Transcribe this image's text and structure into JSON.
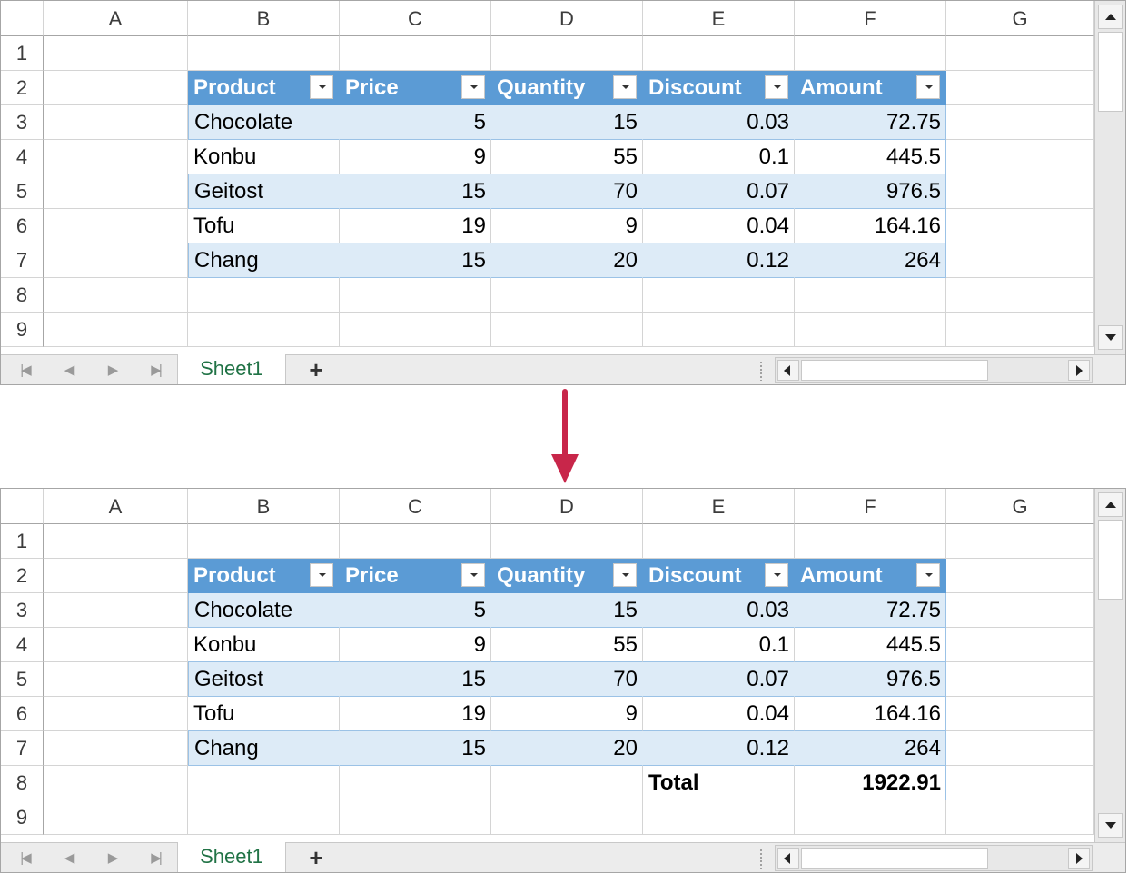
{
  "columns": [
    "A",
    "B",
    "C",
    "D",
    "E",
    "F",
    "G"
  ],
  "row_numbers": [
    "1",
    "2",
    "3",
    "4",
    "5",
    "6",
    "7",
    "8",
    "9"
  ],
  "table": {
    "headers": [
      "Product",
      "Price",
      "Quantity",
      "Discount",
      "Amount"
    ],
    "rows": [
      [
        "Chocolate",
        "5",
        "15",
        "0.03",
        "72.75"
      ],
      [
        "Konbu",
        "9",
        "55",
        "0.1",
        "445.5"
      ],
      [
        "Geitost",
        "15",
        "70",
        "0.07",
        "976.5"
      ],
      [
        "Tofu",
        "19",
        "9",
        "0.04",
        "164.16"
      ],
      [
        "Chang",
        "15",
        "20",
        "0.12",
        "264"
      ]
    ]
  },
  "total_row": {
    "label": "Total",
    "value": "1922.91"
  },
  "sheet_tab": "Sheet1",
  "add_sheet": "+",
  "nav_icons": [
    "first-sheet-icon",
    "prev-sheet-icon",
    "next-sheet-icon",
    "last-sheet-icon"
  ],
  "colors": {
    "header": "#5b9bd5",
    "band": "#ddebf7",
    "arrow": "#c8264a",
    "tab_text": "#217346"
  }
}
